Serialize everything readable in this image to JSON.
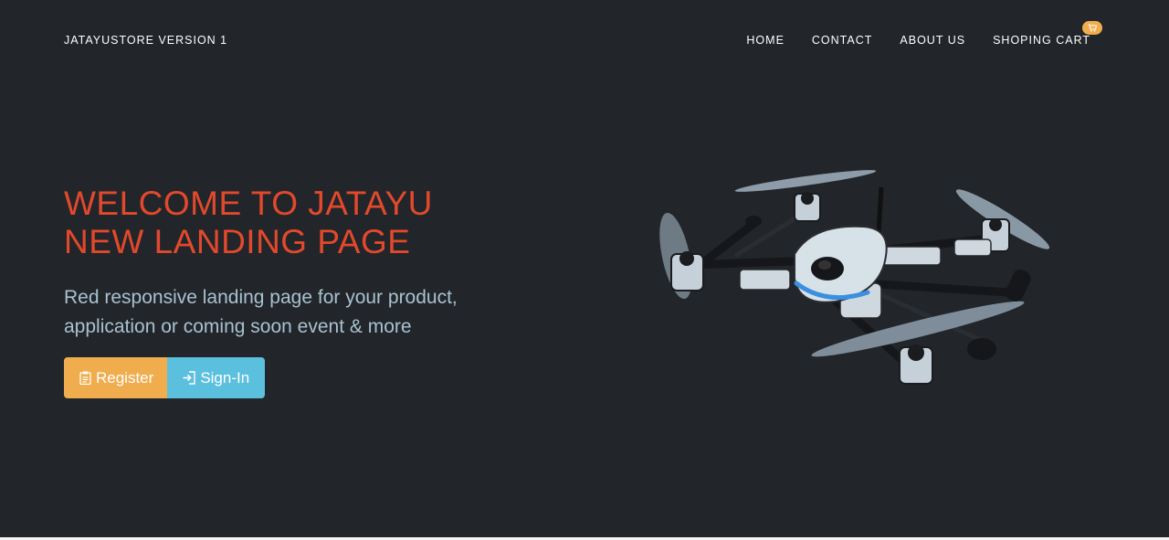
{
  "navbar": {
    "brand": "JATAYUSTORE VERSION 1",
    "links": [
      {
        "label": "HOME"
      },
      {
        "label": "CONTACT"
      },
      {
        "label": "ABOUT US"
      },
      {
        "label": "SHOPING CART",
        "icon": "cart-icon"
      }
    ]
  },
  "hero": {
    "title_line1": "WELCOME TO JATAYU",
    "title_line2": "NEW LANDING PAGE",
    "subtitle_line1": "Red responsive landing page for your product,",
    "subtitle_line2": "application or coming soon event & more",
    "buttons": {
      "register": {
        "label": "Register",
        "icon": "clipboard-icon",
        "color": "#f0ad4e"
      },
      "signin": {
        "label": "Sign-In",
        "icon": "login-icon",
        "color": "#5bc0de"
      }
    },
    "image": "drone-image"
  },
  "colors": {
    "background": "#222529",
    "title": "#e2492c",
    "subtitle": "#a8c2d0",
    "badge": "#f0ad4e"
  }
}
